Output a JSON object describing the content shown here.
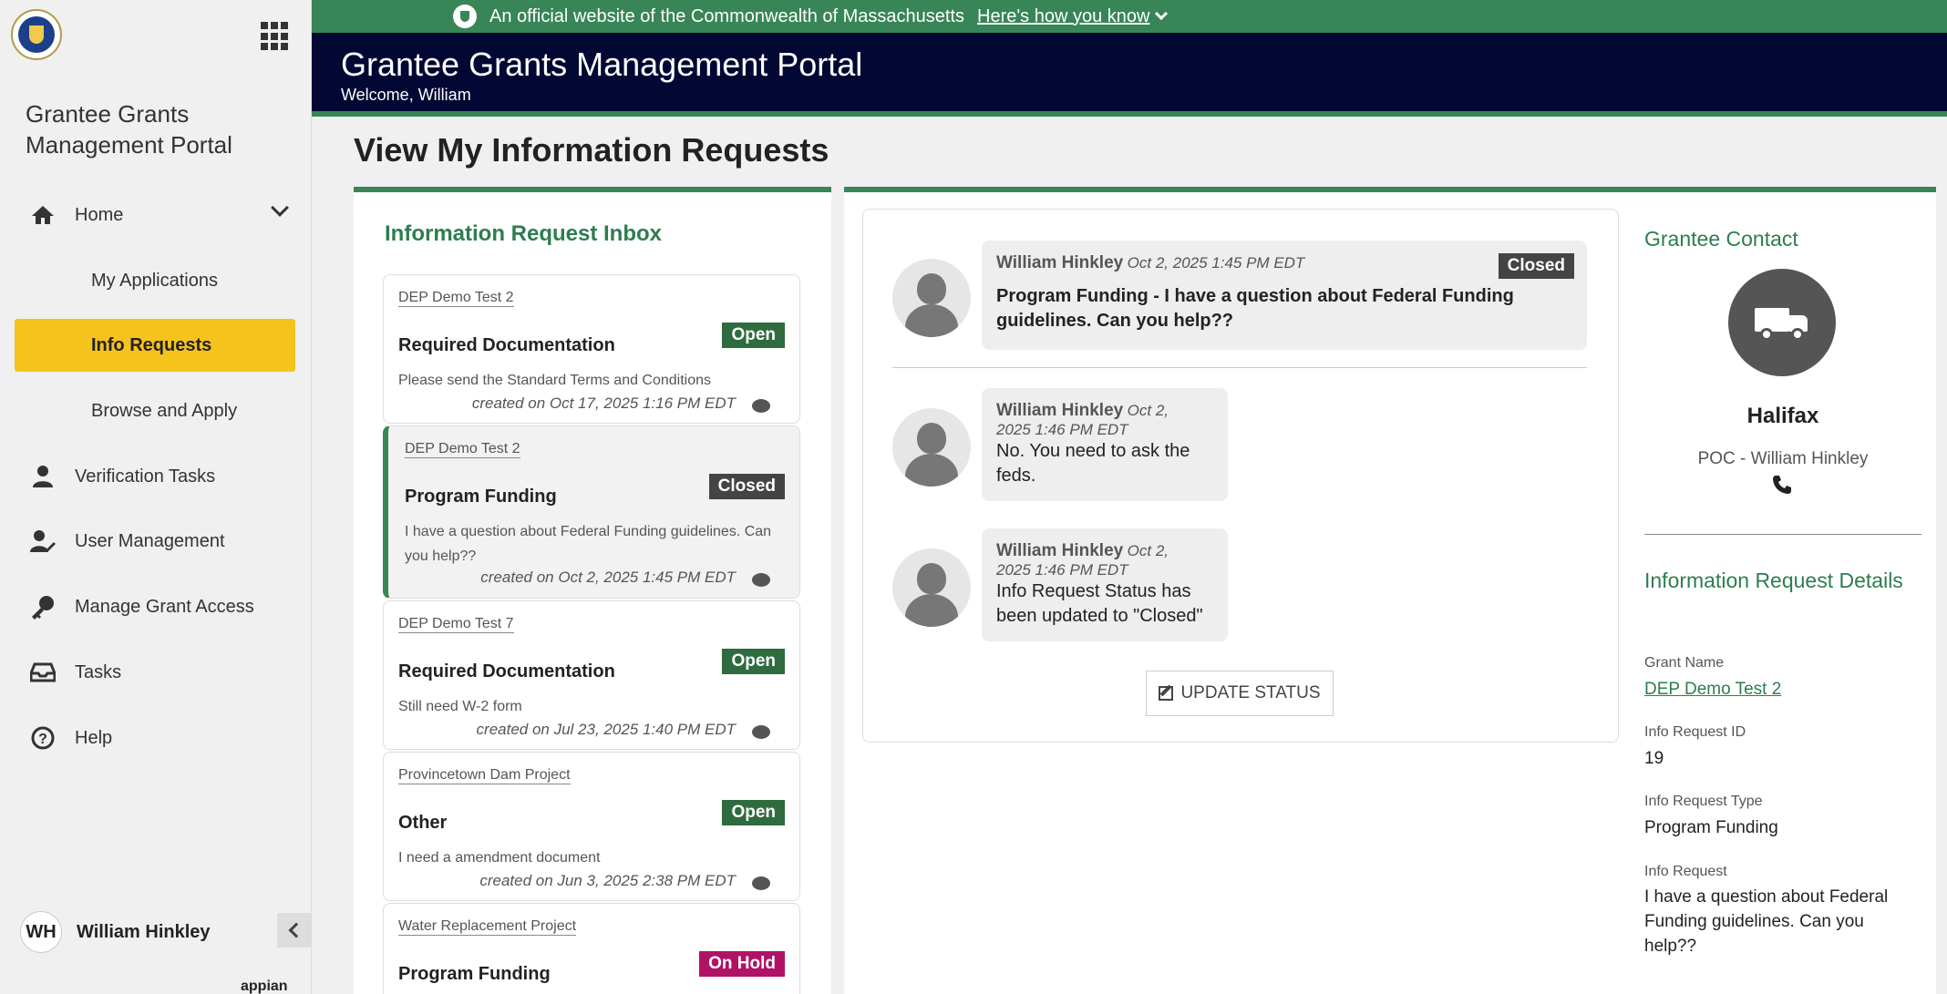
{
  "sidebar": {
    "portal_title": "Grantee Grants Management Portal",
    "nav": {
      "home": "Home",
      "my_applications": "My Applications",
      "info_requests": "Info Requests",
      "browse_apply": "Browse and Apply",
      "verification_tasks": "Verification Tasks",
      "user_management": "User Management",
      "manage_grant_access": "Manage Grant Access",
      "tasks": "Tasks",
      "help": "Help"
    },
    "user": {
      "initials": "WH",
      "name": "William Hinkley"
    },
    "brand": "appian"
  },
  "banner": {
    "text": "An official website of the Commonwealth of Massachusetts",
    "link": "Here's how you know"
  },
  "header": {
    "title": "Grantee Grants Management Portal",
    "welcome": "Welcome, William"
  },
  "page": {
    "title": "View My Information Requests"
  },
  "inbox": {
    "title": "Information Request Inbox",
    "cards": [
      {
        "grant": "DEP Demo Test 2",
        "type": "Required Documentation",
        "status": "Open",
        "desc": "Please send the Standard Terms and Conditions",
        "created": "created on Oct 17, 2025 1:16 PM EDT"
      },
      {
        "grant": "DEP Demo Test 2",
        "type": "Program Funding",
        "status": "Closed",
        "desc": "I have a question about Federal Funding guidelines. Can you help??",
        "created": "created on Oct 2, 2025 1:45 PM EDT"
      },
      {
        "grant": "DEP Demo Test 7",
        "type": "Required Documentation",
        "status": "Open",
        "desc": "Still need W-2 form",
        "created": "created on Jul 23, 2025 1:40 PM EDT"
      },
      {
        "grant": "Provincetown Dam Project",
        "type": "Other",
        "status": "Open",
        "desc": "I need a amendment document",
        "created": "created on Jun 3, 2025 2:38 PM EDT"
      },
      {
        "grant": "Water Replacement Project",
        "type": "Program Funding",
        "status": "On Hold"
      }
    ]
  },
  "conversation": {
    "messages": [
      {
        "author": "William Hinkley",
        "time": "Oct 2, 2025 1:45 PM EDT",
        "badge": "Closed",
        "text": "Program Funding - I have a question about Federal Funding guidelines. Can you help??"
      },
      {
        "author": "William Hinkley",
        "time_line1": "Oct 2,",
        "time_line2": "2025 1:46 PM EDT",
        "text": "No. You need to ask the feds."
      },
      {
        "author": "William Hinkley",
        "time_line1": "Oct 2,",
        "time_line2": "2025 1:46 PM EDT",
        "text": "Info Request Status has been updated to \"Closed\""
      }
    ],
    "update_button": "UPDATE STATUS"
  },
  "contact": {
    "title": "Grantee Contact",
    "name": "Halifax",
    "poc": "POC - William Hinkley",
    "phone_icon": "phone-icon"
  },
  "details": {
    "title": "Information Request Details",
    "grant_name_label": "Grant Name",
    "grant_name": "DEP Demo Test 2",
    "id_label": "Info Request ID",
    "id": "19",
    "type_label": "Info Request Type",
    "type": "Program Funding",
    "request_label": "Info Request",
    "request": "I have a question about Federal Funding guidelines. Can you help??"
  },
  "colors": {
    "brand_green": "#388557",
    "header_navy": "#030733",
    "active_nav": "#f6c21c",
    "on_hold": "#b01266"
  }
}
